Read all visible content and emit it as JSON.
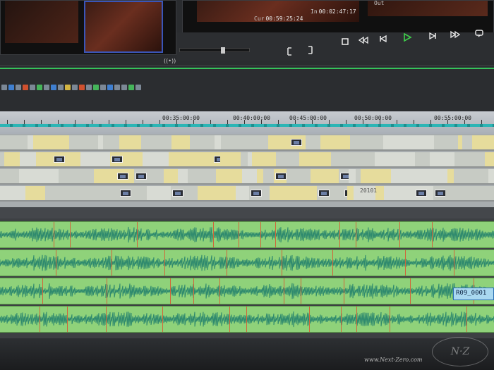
{
  "monitors": {
    "cur_label": "Cur",
    "cur_tc": "00:59:25:24",
    "in_label": "In",
    "in_tc": "00:02:47:17",
    "out_label": "Out"
  },
  "transport": {
    "buttons": [
      "mark-in-icon",
      "mark-out-icon",
      "stop-icon",
      "rewind-icon",
      "step-back-icon",
      "play-icon",
      "step-forward-icon",
      "fast-forward-icon",
      "loop-icon"
    ]
  },
  "ruler": {
    "labels": [
      "00:35:00:00",
      "00:40:00:00",
      "00:45:00:00",
      "00:50:00:00",
      "00:55:00:00"
    ]
  },
  "video": {
    "clip_name": "20101"
  },
  "audio": {
    "clip_label": "R09_0001"
  },
  "colors": {
    "video_clip": "#e6dc9c",
    "audio_clip": "#8fd27a",
    "audio_waveform": "#2f8a6e",
    "ruler_bar": "#2cb5b5",
    "play_green": "#3fcf4b",
    "selection_blue": "#2a6fb2"
  },
  "watermark": {
    "text": "www.Next-Zero.com"
  }
}
